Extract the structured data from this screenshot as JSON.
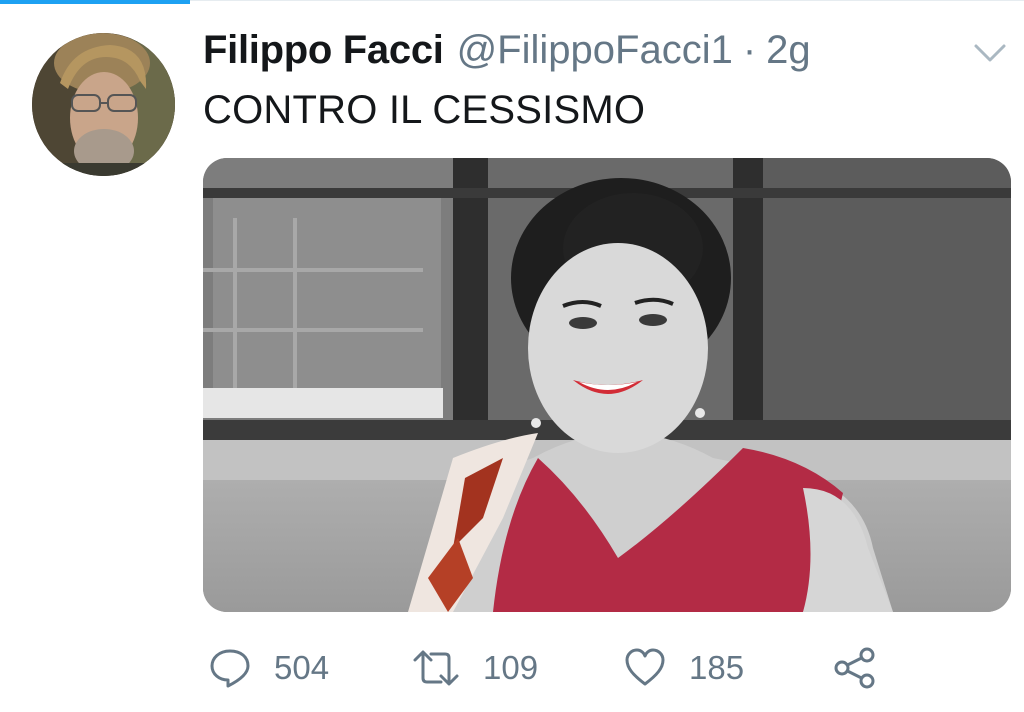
{
  "tweet": {
    "display_name": "Filippo Facci",
    "handle": "@FilippoFacci1",
    "separator": "·",
    "time": "2g",
    "text": "CONTRO IL CESSISMO"
  },
  "actions": {
    "replies": "504",
    "retweets": "109",
    "likes": "185"
  },
  "colors": {
    "accent": "#1da1f2",
    "secondary_text": "#657786",
    "primary_text": "#14171a",
    "dress_red": "#b32b45"
  },
  "icons": [
    "chevron-down-icon",
    "reply-icon",
    "retweet-icon",
    "heart-icon",
    "share-icon"
  ]
}
